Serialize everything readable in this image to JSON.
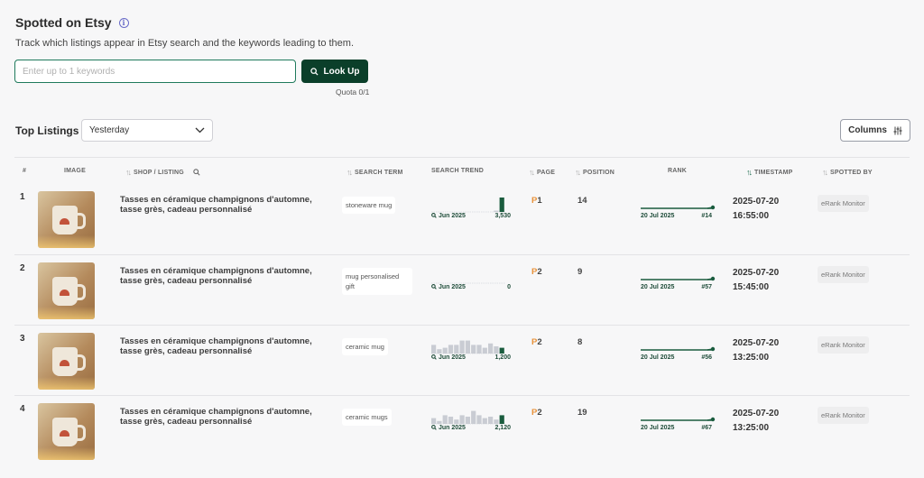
{
  "header": {
    "title": "Spotted on Etsy",
    "info_icon": "i",
    "subtitle": "Track which listings appear in Etsy search and the keywords leading to them."
  },
  "search": {
    "placeholder": "Enter up to 1 keywords",
    "button_label": "Look Up",
    "quota": "Quota 0/1"
  },
  "toolbar": {
    "section_title": "Top Listings",
    "period_selected": "Yesterday",
    "columns_label": "Columns"
  },
  "table": {
    "columns": {
      "num": "#",
      "image": "IMAGE",
      "shop_listing": "SHOP / LISTING",
      "search_term": "SEARCH TERM",
      "search_trend": "SEARCH TREND",
      "page": "PAGE",
      "position": "POSITION",
      "rank": "RANK",
      "timestamp": "TIMESTAMP",
      "spotted_by": "SPOTTED BY"
    },
    "rows": [
      {
        "num": "1",
        "title": "Tasses en céramique champignons d'automne, tasse grès, cadeau personnalisé",
        "term": "stoneware mug",
        "trend_date": "Jun 2025",
        "trend_value": "3,530",
        "trend_bars": [
          0,
          0,
          0,
          0,
          0,
          0,
          0,
          0,
          0,
          0,
          0,
          0.05,
          1.0
        ],
        "page_prefix": "P",
        "page_num": "1",
        "position": "14",
        "rank_date": "20 Jul 2025",
        "rank_pos": "#14",
        "ts_date": "2025-07-20",
        "ts_time": "16:55:00",
        "spotted_by": "eRank Monitor"
      },
      {
        "num": "2",
        "title": "Tasses en céramique champignons d'automne, tasse grès, cadeau personnalisé",
        "term": "mug personalised gift",
        "trend_date": "Jun 2025",
        "trend_value": "0",
        "trend_bars": [
          0,
          0,
          0,
          0,
          0,
          0,
          0,
          0,
          0,
          0,
          0,
          0,
          0
        ],
        "page_prefix": "P",
        "page_num": "2",
        "position": "9",
        "rank_date": "20 Jul 2025",
        "rank_pos": "#57",
        "ts_date": "2025-07-20",
        "ts_time": "15:45:00",
        "spotted_by": "eRank Monitor"
      },
      {
        "num": "3",
        "title": "Tasses en céramique champignons d'automne, tasse grès, cadeau personnalisé",
        "term": "ceramic mug",
        "trend_date": "Jun 2025",
        "trend_value": "1,200",
        "trend_bars": [
          0.6,
          0.3,
          0.4,
          0.6,
          0.6,
          0.9,
          0.9,
          0.6,
          0.6,
          0.4,
          0.7,
          0.5,
          0.4
        ],
        "page_prefix": "P",
        "page_num": "2",
        "position": "8",
        "rank_date": "20 Jul 2025",
        "rank_pos": "#56",
        "ts_date": "2025-07-20",
        "ts_time": "13:25:00",
        "spotted_by": "eRank Monitor"
      },
      {
        "num": "4",
        "title": "Tasses en céramique champignons d'automne, tasse grès, cadeau personnalisé",
        "term": "ceramic mugs",
        "trend_date": "Jun 2025",
        "trend_value": "2,120",
        "trend_bars": [
          0.4,
          0.2,
          0.6,
          0.5,
          0.3,
          0.6,
          0.5,
          0.9,
          0.6,
          0.4,
          0.5,
          0.3,
          0.6
        ],
        "page_prefix": "P",
        "page_num": "2",
        "position": "19",
        "rank_date": "20 Jul 2025",
        "rank_pos": "#67",
        "ts_date": "2025-07-20",
        "ts_time": "13:25:00",
        "spotted_by": "eRank Monitor"
      }
    ]
  },
  "colors": {
    "accent": "#0b3f2a",
    "trend_bar": "#c9ccd3",
    "trend_highlight": "#1a5c3e",
    "page_prefix": "#e8923a"
  }
}
